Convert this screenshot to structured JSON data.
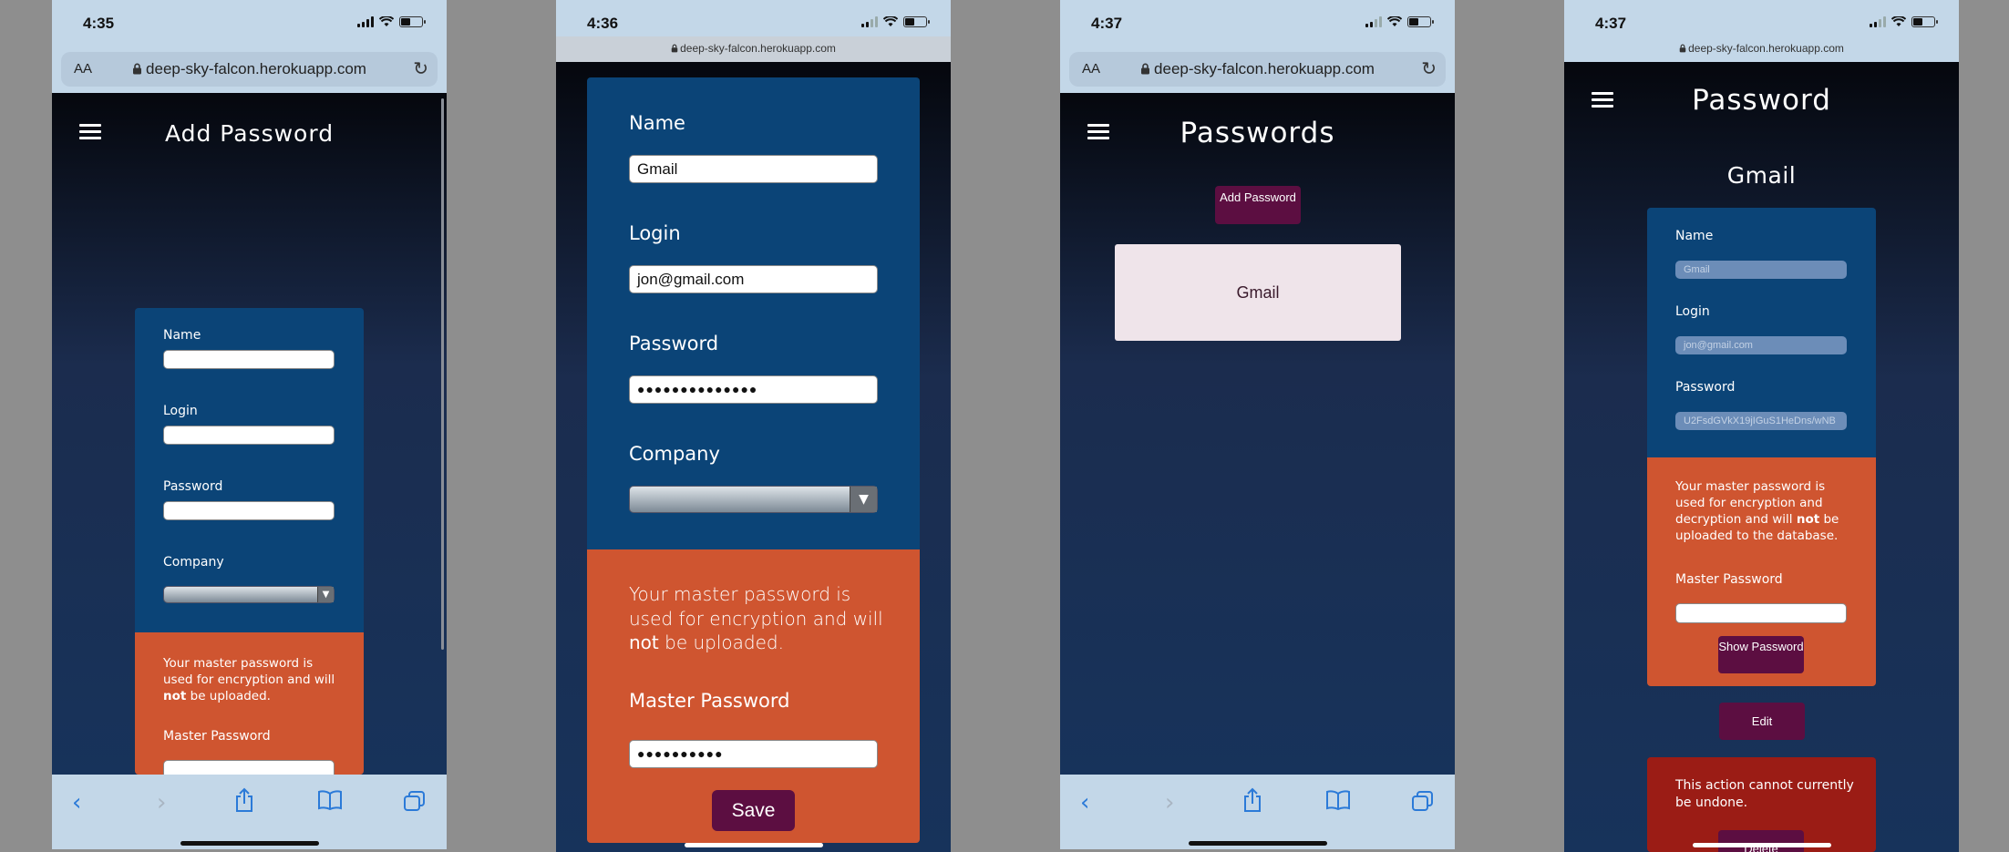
{
  "screen1": {
    "time": "4:35",
    "aa": "AA",
    "url": "deep-sky-falcon.herokuapp.com",
    "title": "Add Password",
    "labels": {
      "name": "Name",
      "login": "Login",
      "password": "Password",
      "company": "Company",
      "master": "Master Password"
    },
    "note_a": "Your master password is used for encryption and will",
    "note_bold": "not",
    "note_b": "be uploaded."
  },
  "screen2": {
    "time": "4:36",
    "url": "deep-sky-falcon.herokuapp.com",
    "labels": {
      "name": "Name",
      "login": "Login",
      "password": "Password",
      "company": "Company",
      "master": "Master Password"
    },
    "values": {
      "name": "Gmail",
      "login": "jon@gmail.com",
      "password": "●●●●●●●●●●●●●●",
      "master": "●●●●●●●●●●"
    },
    "note_a": "Your master password is used for encryption and will",
    "note_bold": "not",
    "note_b": "be uploaded.",
    "save": "Save"
  },
  "screen3": {
    "time": "4:37",
    "aa": "AA",
    "url": "deep-sky-falcon.herokuapp.com",
    "title": "Passwords",
    "add_button": "Add Password",
    "entry": "Gmail"
  },
  "screen4": {
    "time": "4:37",
    "url": "deep-sky-falcon.herokuapp.com",
    "title": "Password",
    "subtitle": "Gmail",
    "labels": {
      "name": "Name",
      "login": "Login",
      "password": "Password",
      "master": "Master Password"
    },
    "values": {
      "name": "Gmail",
      "login": "jon@gmail.com",
      "password": "U2FsdGVkX19jIGuS1HeDns/wNB"
    },
    "note_a": "Your master password is used for encryption and decryption and will",
    "note_bold": "not",
    "note_b": "be uploaded to the database.",
    "show_button": "Show Password",
    "edit_button": "Edit",
    "warning": "This action cannot currently be undone.",
    "delete_button": "Delete"
  },
  "icons": {
    "back": "chevron-left",
    "forward": "chevron-right",
    "share": "share",
    "bookmarks": "book",
    "tabs": "tabs",
    "menu": "hamburger",
    "lock": "lock",
    "reload": "reload",
    "dropdown": "triangle-down"
  },
  "colors": {
    "browser_chrome": "#c3d7e8",
    "card_blue": "#0b4477",
    "orange": "#cf5530",
    "button": "#5c0e41",
    "danger": "#9b1c15",
    "list_item": "#efe4ea"
  }
}
